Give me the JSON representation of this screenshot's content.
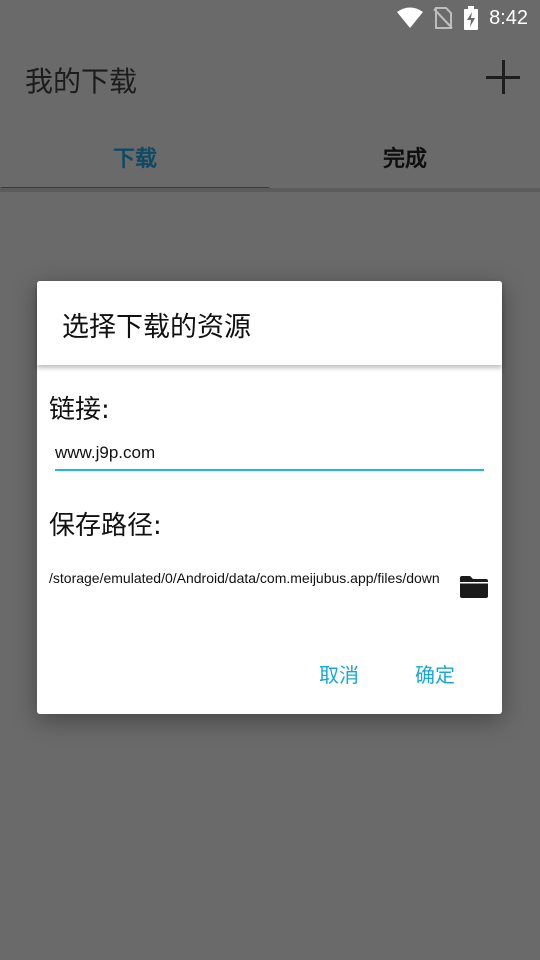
{
  "status_bar": {
    "time": "8:42"
  },
  "app_bar": {
    "title": "我的下载"
  },
  "tabs": [
    {
      "label": "下载",
      "selected": true
    },
    {
      "label": "完成",
      "selected": false
    }
  ],
  "dialog": {
    "title": "选择下载的资源",
    "link_label": "链接:",
    "link_value": "www.j9p.com",
    "path_label": "保存路径:",
    "path_value": "/storage/emulated/0/Android/data/com.meijubus.app/files/down",
    "cancel_label": "取消",
    "ok_label": "确定"
  },
  "colors": {
    "accent": "#19a7d8",
    "tab_selected": "#0f4a64",
    "scrim_background": "#6a6a6a"
  },
  "icons": [
    "wifi-icon",
    "no-sim-icon",
    "battery-charging-icon",
    "add-icon",
    "folder-icon"
  ]
}
